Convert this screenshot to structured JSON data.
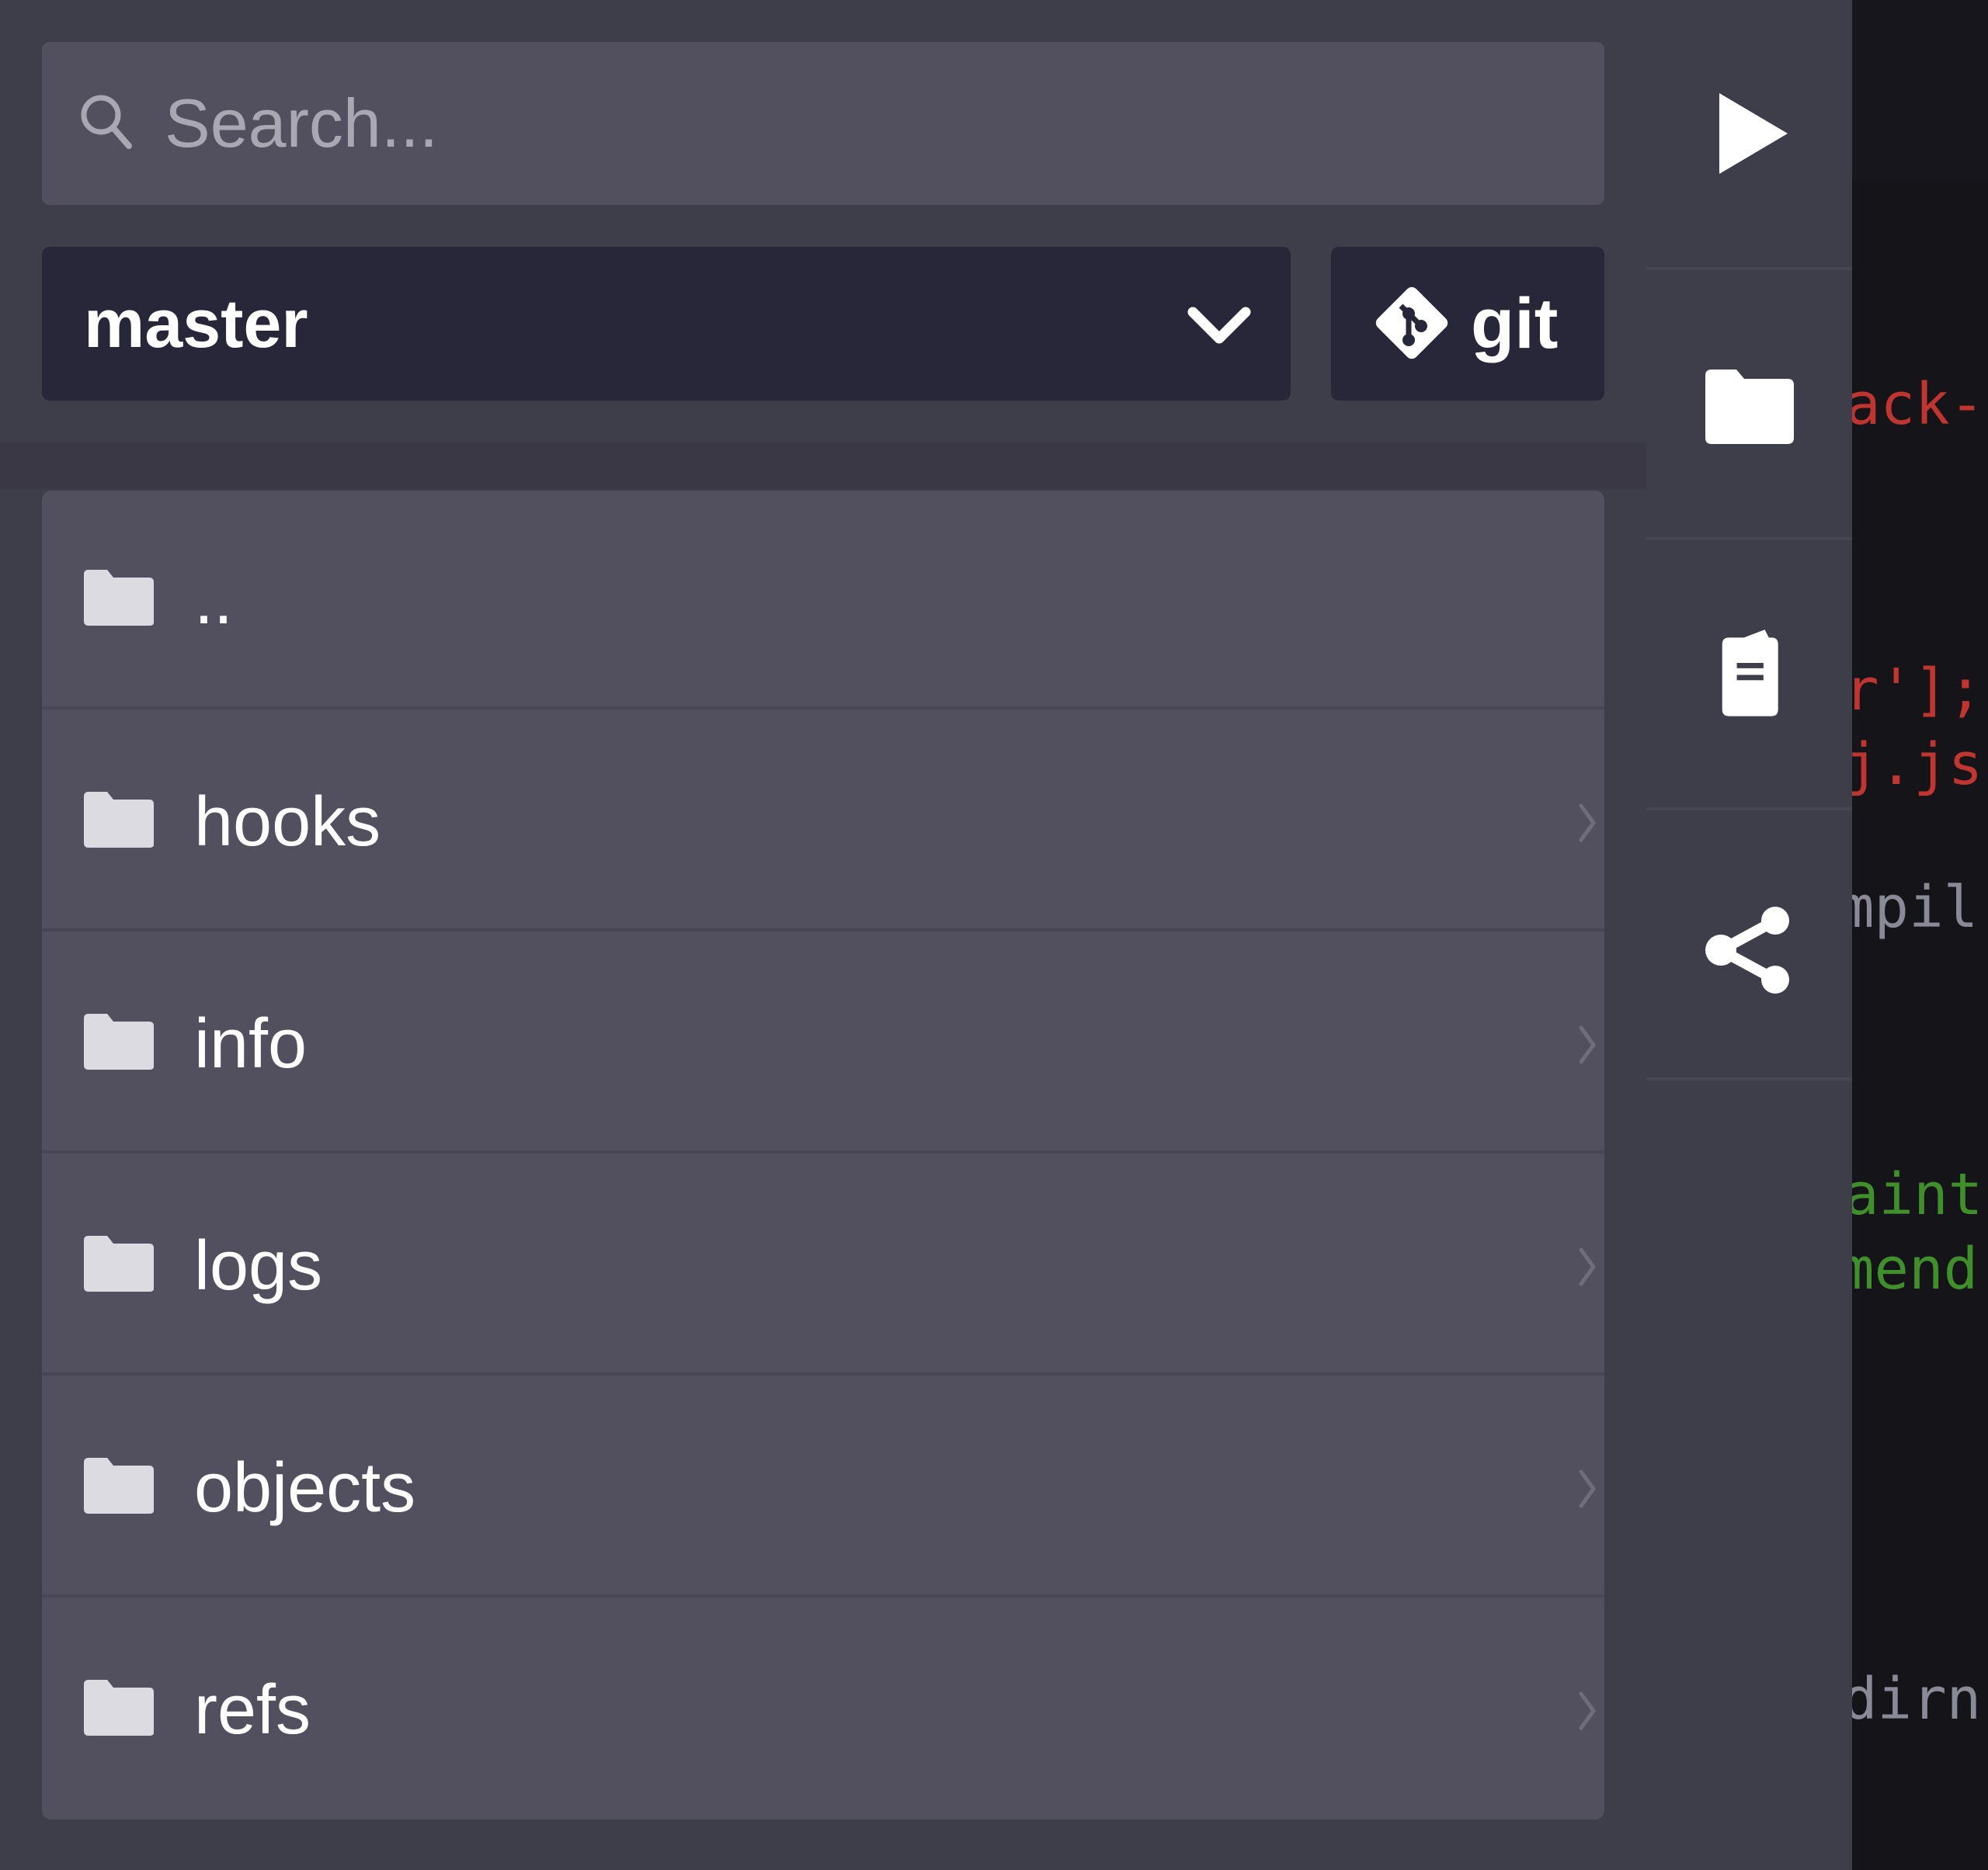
{
  "search": {
    "placeholder": "Search..."
  },
  "branch": {
    "selected": "master"
  },
  "git_button": {
    "label": "git"
  },
  "files": [
    {
      "name": "..",
      "has_chevron": false
    },
    {
      "name": "hooks",
      "has_chevron": true
    },
    {
      "name": "info",
      "has_chevron": true
    },
    {
      "name": "logs",
      "has_chevron": true
    },
    {
      "name": "objects",
      "has_chevron": true
    },
    {
      "name": "refs",
      "has_chevron": true
    }
  ],
  "toolbar": {
    "icons": [
      "play-icon",
      "folder-icon",
      "clipboard-icon",
      "share-icon"
    ]
  },
  "editor_fragments": [
    {
      "text": "ack-",
      "color": "#c0352f"
    },
    {
      "text": "r'];",
      "color": "#c0352f"
    },
    {
      "text": "j.js",
      "color": "#c0352f"
    },
    {
      "text": "mpil",
      "color": "#8a8996"
    },
    {
      "text": "aint",
      "color": "#3f8f2a"
    },
    {
      "text": "mend",
      "color": "#3f8f2a"
    },
    {
      "text": "dirn",
      "color": "#8a8996"
    }
  ],
  "colors": {
    "sidebar_bg": "#3e3d4a",
    "card_bg": "#52505e",
    "dark_control_bg": "#28273a",
    "editor_bg": "#151419",
    "text": "#ffffff"
  }
}
